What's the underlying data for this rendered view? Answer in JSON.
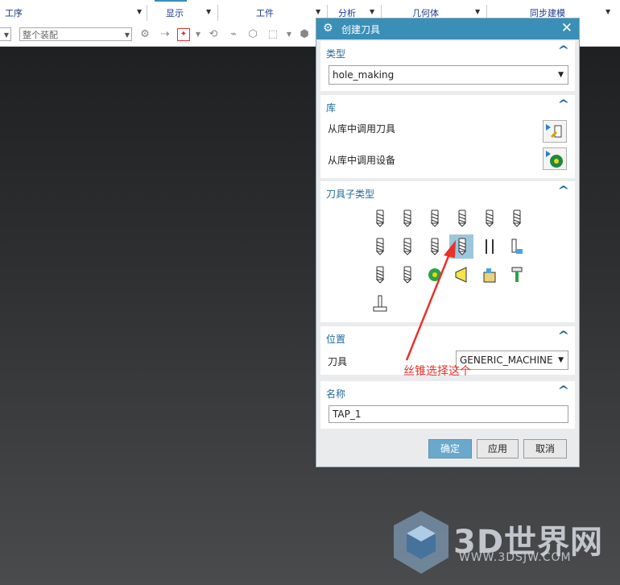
{
  "ribbon": {
    "groups": [
      {
        "label": "工序"
      },
      {
        "label": "显示"
      },
      {
        "label": "工件"
      },
      {
        "label": "分析"
      },
      {
        "label": "几何体"
      },
      {
        "label": "同步建模"
      }
    ],
    "assembly_combo": "整个装配"
  },
  "dialog": {
    "title": "创建刀具",
    "type_section": {
      "header": "类型",
      "selected": "hole_making"
    },
    "library_section": {
      "header": "库",
      "retrieve_tool": "从库中调用刀具",
      "retrieve_device": "从库中调用设备"
    },
    "subtype_section": {
      "header": "刀具子类型",
      "selected_index": 9
    },
    "location_section": {
      "header": "位置",
      "tool_label": "刀具",
      "tool_value": "GENERIC_MACHINE"
    },
    "name_section": {
      "header": "名称",
      "value": "TAP_1"
    },
    "buttons": {
      "ok": "确定",
      "apply": "应用",
      "cancel": "取消"
    }
  },
  "annotation": {
    "text": "丝锥选择这个",
    "color": "#e8322b"
  },
  "watermark": {
    "brand": "3D世界网",
    "url": "WWW.3DSJW.COM"
  },
  "colors": {
    "titlebar": "#3a8fb7",
    "section_header": "#1f6a9e",
    "selection": "#9cc6dc"
  }
}
